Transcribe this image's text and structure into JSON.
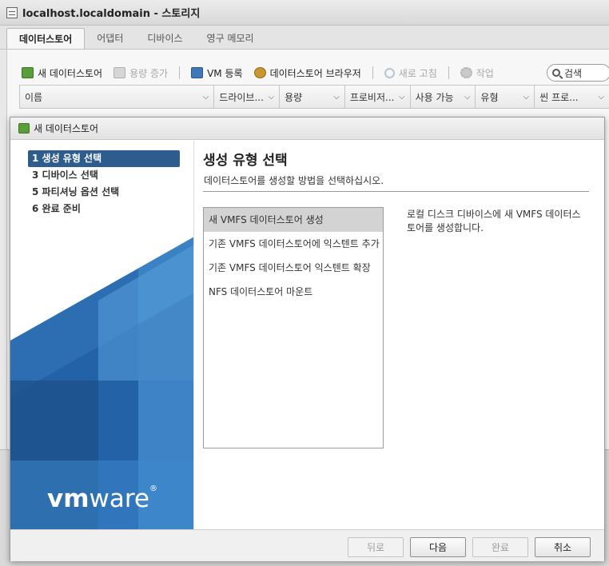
{
  "window": {
    "title": "localhost.localdomain - 스토리지"
  },
  "tabs": [
    {
      "label": "데이터스토어",
      "active": true
    },
    {
      "label": "어댑터",
      "active": false
    },
    {
      "label": "디바이스",
      "active": false
    },
    {
      "label": "영구 메모리",
      "active": false
    }
  ],
  "toolbar": {
    "new_datastore": "새 데이터스토어",
    "increase_capacity": "용량 증가",
    "register_vm": "VM 등록",
    "datastore_browser": "데이터스토어 브라우저",
    "refresh": "새로 고침",
    "actions": "작업",
    "search_placeholder": "검색"
  },
  "grid_columns": [
    "이름",
    "드라이브...",
    "용량",
    "프로비저...",
    "사용 가능",
    "유형",
    "씬 프로..."
  ],
  "dialog": {
    "title": "새 데이터스토어",
    "steps": [
      {
        "label": "1 생성 유형 선택",
        "active": true
      },
      {
        "label": "3 디바이스 선택",
        "active": false
      },
      {
        "label": "5 파티셔닝 옵션 선택",
        "active": false
      },
      {
        "label": "6 완료 준비",
        "active": false
      }
    ],
    "logo": {
      "prefix": "vm",
      "suffix": "ware",
      "mark": "®"
    },
    "heading": "생성 유형 선택",
    "description": "데이터스토어를 생성할 방법을 선택하십시오.",
    "options": [
      {
        "label": "새 VMFS 데이터스토어 생성",
        "selected": true
      },
      {
        "label": "기존 VMFS 데이터스토어에 익스텐트 추가",
        "selected": false
      },
      {
        "label": "기존 VMFS 데이터스토어 익스텐트 확장",
        "selected": false
      },
      {
        "label": "NFS 데이터스토어 마운트",
        "selected": false
      }
    ],
    "option_detail": "로컬 디스크 디바이스에 새 VMFS 데이터스토어를 생성합니다.",
    "buttons": {
      "back": "뒤로",
      "next": "다음",
      "finish": "완료",
      "cancel": "취소"
    }
  },
  "colors": {
    "accent": "#2f5c8f",
    "sidebar_blue_dark": "#1d4e86",
    "sidebar_blue_light": "#3b82c4"
  },
  "icons": [
    "datastore-icon",
    "new-datastore-icon",
    "increase-capacity-icon",
    "register-vm-icon",
    "datastore-browser-icon",
    "refresh-icon",
    "actions-gear-icon",
    "search-icon",
    "chevron-down-icon"
  ]
}
